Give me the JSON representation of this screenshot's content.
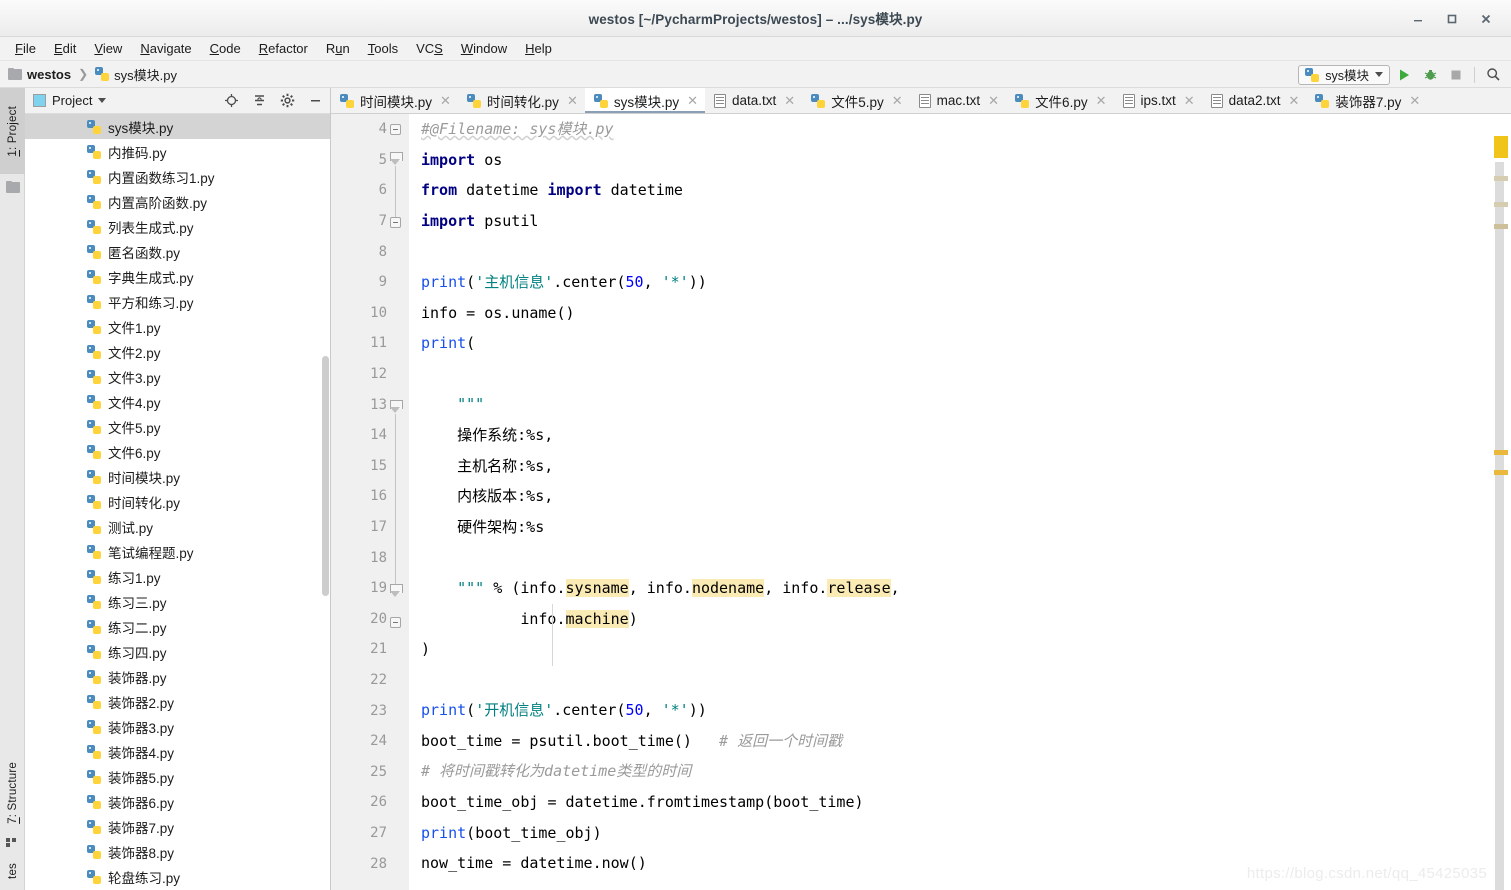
{
  "window": {
    "title": "westos [~/PycharmProjects/westos] – .../sys模块.py",
    "minimize_label": "—",
    "maximize_label": "▢",
    "close_label": "✕"
  },
  "menubar": {
    "items": [
      {
        "label": "File",
        "mnemonic": "F"
      },
      {
        "label": "Edit",
        "mnemonic": "E"
      },
      {
        "label": "View",
        "mnemonic": "V"
      },
      {
        "label": "Navigate",
        "mnemonic": "N"
      },
      {
        "label": "Code",
        "mnemonic": "C"
      },
      {
        "label": "Refactor",
        "mnemonic": "R"
      },
      {
        "label": "Run",
        "mnemonic": "u"
      },
      {
        "label": "Tools",
        "mnemonic": "T"
      },
      {
        "label": "VCS",
        "mnemonic": "S"
      },
      {
        "label": "Window",
        "mnemonic": "W"
      },
      {
        "label": "Help",
        "mnemonic": "H"
      }
    ]
  },
  "breadcrumb": {
    "project": "westos",
    "separator": "❯",
    "file": "sys模块.py"
  },
  "toolbar": {
    "run_config": "sys模块",
    "run_button": "run-icon",
    "debug_button": "debug-icon",
    "stop_button": "stop-icon",
    "search_button": "search-icon"
  },
  "left_tool_strip": {
    "tabs": [
      {
        "label": "1: Project",
        "mnemonic": "1",
        "active": true
      },
      {
        "label": "7: Structure",
        "mnemonic": "7",
        "active": false
      },
      {
        "label": "tes",
        "mnemonic": "",
        "active": false
      }
    ]
  },
  "project_panel": {
    "title": "Project",
    "icons": [
      "locate-icon",
      "collapse-all-icon",
      "settings-gear-icon",
      "hide-icon"
    ],
    "files": [
      {
        "name": "sys模块.py",
        "type": "py",
        "selected": true
      },
      {
        "name": "内推码.py",
        "type": "py",
        "selected": false
      },
      {
        "name": "内置函数练习1.py",
        "type": "py",
        "selected": false
      },
      {
        "name": "内置高阶函数.py",
        "type": "py",
        "selected": false
      },
      {
        "name": "列表生成式.py",
        "type": "py",
        "selected": false
      },
      {
        "name": "匿名函数.py",
        "type": "py",
        "selected": false
      },
      {
        "name": "字典生成式.py",
        "type": "py",
        "selected": false
      },
      {
        "name": "平方和练习.py",
        "type": "py",
        "selected": false
      },
      {
        "name": "文件1.py",
        "type": "py",
        "selected": false
      },
      {
        "name": "文件2.py",
        "type": "py",
        "selected": false
      },
      {
        "name": "文件3.py",
        "type": "py",
        "selected": false
      },
      {
        "name": "文件4.py",
        "type": "py",
        "selected": false
      },
      {
        "name": "文件5.py",
        "type": "py",
        "selected": false
      },
      {
        "name": "文件6.py",
        "type": "py",
        "selected": false
      },
      {
        "name": "时间模块.py",
        "type": "py",
        "selected": false
      },
      {
        "name": "时间转化.py",
        "type": "py",
        "selected": false
      },
      {
        "name": "测试.py",
        "type": "py",
        "selected": false
      },
      {
        "name": "笔试编程题.py",
        "type": "py",
        "selected": false
      },
      {
        "name": "练习1.py",
        "type": "py",
        "selected": false
      },
      {
        "name": "练习三.py",
        "type": "py",
        "selected": false
      },
      {
        "name": "练习二.py",
        "type": "py",
        "selected": false
      },
      {
        "name": "练习四.py",
        "type": "py",
        "selected": false
      },
      {
        "name": "装饰器.py",
        "type": "py",
        "selected": false
      },
      {
        "name": "装饰器2.py",
        "type": "py",
        "selected": false
      },
      {
        "name": "装饰器3.py",
        "type": "py",
        "selected": false
      },
      {
        "name": "装饰器4.py",
        "type": "py",
        "selected": false
      },
      {
        "name": "装饰器5.py",
        "type": "py",
        "selected": false
      },
      {
        "name": "装饰器6.py",
        "type": "py",
        "selected": false
      },
      {
        "name": "装饰器7.py",
        "type": "py",
        "selected": false
      },
      {
        "name": "装饰器8.py",
        "type": "py",
        "selected": false
      },
      {
        "name": "轮盘练习.py",
        "type": "py",
        "selected": false
      }
    ]
  },
  "editor_tabs": [
    {
      "label": "时间模块.py",
      "type": "py",
      "active": false,
      "close": "✕"
    },
    {
      "label": "时间转化.py",
      "type": "py",
      "active": false,
      "close": "✕"
    },
    {
      "label": "sys模块.py",
      "type": "py",
      "active": true,
      "close": "✕"
    },
    {
      "label": "data.txt",
      "type": "txt",
      "active": false,
      "close": "✕"
    },
    {
      "label": "文件5.py",
      "type": "py",
      "active": false,
      "close": "✕"
    },
    {
      "label": "mac.txt",
      "type": "txt",
      "active": false,
      "close": "✕"
    },
    {
      "label": "文件6.py",
      "type": "py",
      "active": false,
      "close": "✕"
    },
    {
      "label": "ips.txt",
      "type": "txt",
      "active": false,
      "close": "✕"
    },
    {
      "label": "data2.txt",
      "type": "txt",
      "active": false,
      "close": "✕"
    },
    {
      "label": "装饰器7.py",
      "type": "py",
      "active": false,
      "close": "✕"
    }
  ],
  "editor": {
    "first_line_number": 4,
    "line_numbers": [
      4,
      5,
      6,
      7,
      8,
      9,
      10,
      11,
      12,
      13,
      14,
      15,
      16,
      17,
      18,
      19,
      20,
      21,
      22,
      23,
      24,
      25,
      26,
      27,
      28
    ],
    "lines": [
      {
        "n": 4,
        "text": "#@Filename: sys模块.py"
      },
      {
        "n": 5,
        "text": "import os"
      },
      {
        "n": 6,
        "text": "from datetime import datetime"
      },
      {
        "n": 7,
        "text": "import psutil"
      },
      {
        "n": 8,
        "text": ""
      },
      {
        "n": 9,
        "text": "print('主机信息'.center(50, '*'))"
      },
      {
        "n": 10,
        "text": "info = os.uname()"
      },
      {
        "n": 11,
        "text": "print("
      },
      {
        "n": 12,
        "text": ""
      },
      {
        "n": 13,
        "text": "    \"\"\""
      },
      {
        "n": 14,
        "text": "    操作系统:%s,"
      },
      {
        "n": 15,
        "text": "    主机名称:%s,"
      },
      {
        "n": 16,
        "text": "    内核版本:%s,"
      },
      {
        "n": 17,
        "text": "    硬件架构:%s"
      },
      {
        "n": 18,
        "text": ""
      },
      {
        "n": 19,
        "text": "    \"\"\" % (info.sysname, info.nodename, info.release,"
      },
      {
        "n": 20,
        "text": "           info.machine)"
      },
      {
        "n": 21,
        "text": ")"
      },
      {
        "n": 22,
        "text": ""
      },
      {
        "n": 23,
        "text": "print('开机信息'.center(50, '*'))"
      },
      {
        "n": 24,
        "text": "boot_time = psutil.boot_time()   # 返回一个时间戳"
      },
      {
        "n": 25,
        "text": "# 将时间戳转化为datetime类型的时间"
      },
      {
        "n": 26,
        "text": "boot_time_obj = datetime.fromtimestamp(boot_time)"
      },
      {
        "n": 27,
        "text": "print(boot_time_obj)"
      },
      {
        "n": 28,
        "text": "now_time = datetime.now()"
      }
    ],
    "highlighted_tokens": [
      "sysname",
      "nodename",
      "release",
      "machine"
    ],
    "colors": {
      "keyword": "#000080",
      "string": "#008080",
      "number": "#0000ff",
      "function": "#1750eb",
      "comment": "#9a9a9a",
      "highlight": "#faeab4",
      "gutter_bg": "#f0f0f0",
      "editor_bg": "#ffffff"
    }
  },
  "watermark": "https://blog.csdn.net/qq_45425035"
}
